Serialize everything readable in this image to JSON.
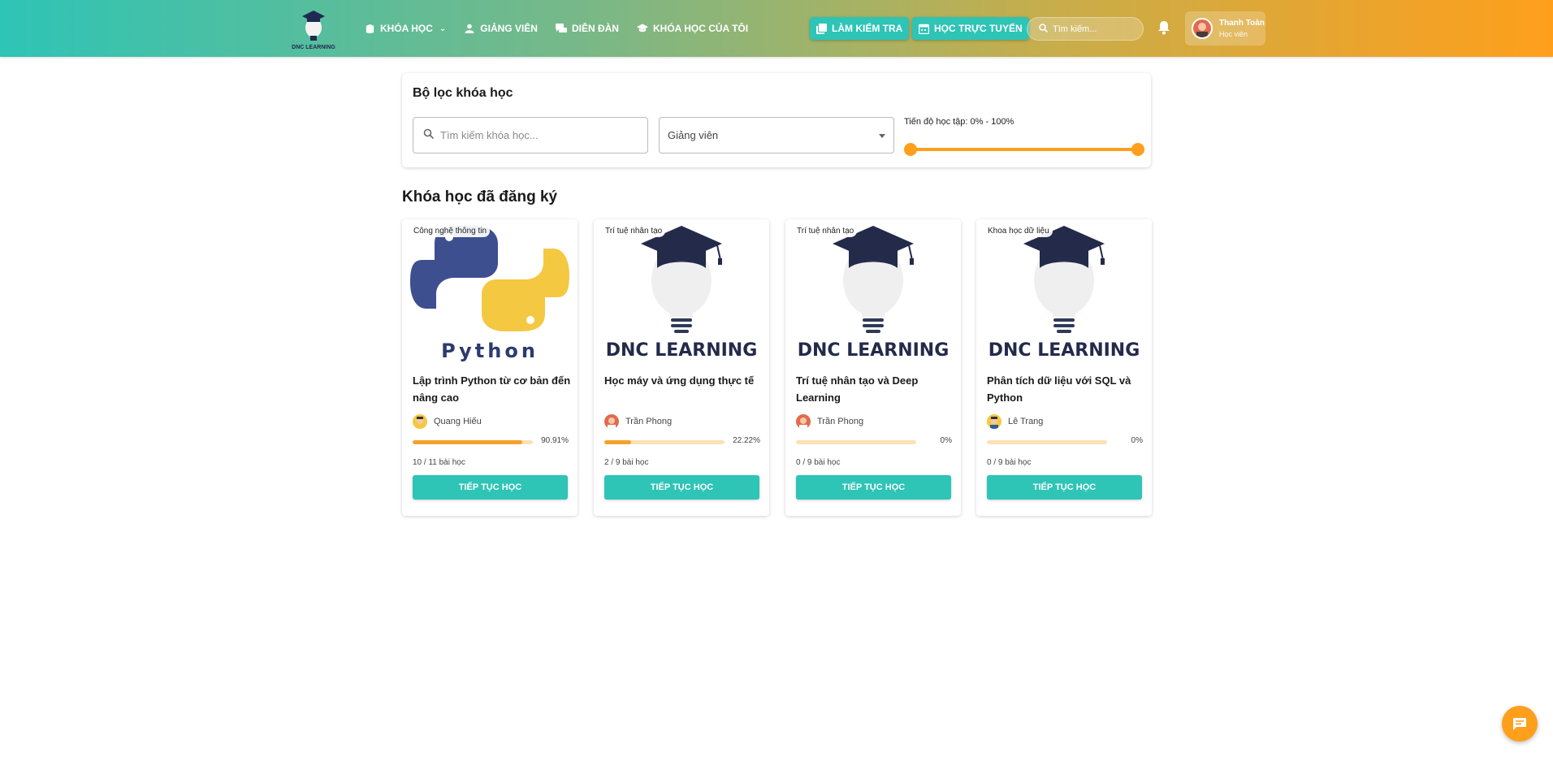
{
  "header": {
    "logo_text": "DNC LEARNING",
    "nav": [
      {
        "label": "KHÓA HỌC",
        "icon": "book-icon"
      },
      {
        "label": "GIẢNG VIÊN",
        "icon": "person-icon"
      },
      {
        "label": "DIỄN ĐÀN",
        "icon": "forum-icon"
      },
      {
        "label": "KHÓA HỌC CỦA TÔI",
        "icon": "school-icon"
      }
    ],
    "btn_test": "LÀM KIỂM TRA",
    "btn_online": "HỌC TRỰC TUYẾN",
    "search_placeholder": "Tìm kiếm...",
    "user": {
      "name": "Thanh Toàn",
      "role": "Học viên"
    }
  },
  "filter": {
    "title": "Bộ lọc khóa học",
    "search_placeholder": "Tìm kiếm khóa học...",
    "instructor_select": "Giảng viên",
    "progress_label": "Tiến độ học tập: 0% - 100%",
    "progress_range": [
      0,
      100
    ]
  },
  "section_title": "Khóa học đã đăng ký",
  "courses": [
    {
      "category": "Công nghệ thông tin",
      "image_text": "Python",
      "title": "Lập trình Python từ cơ bản đến nâng cao",
      "instructor": "Quang Hiếu",
      "progress": 90.91,
      "progress_label": "90.91%",
      "lessons": "10 / 11 bài học",
      "button": "TIẾP TỤC HỌC"
    },
    {
      "category": "Trí tuệ nhân tạo",
      "image_text": "DNC LEARNING",
      "title": "Học máy và ứng dụng thực tế",
      "instructor": "Trần Phong",
      "progress": 22.22,
      "progress_label": "22.22%",
      "lessons": "2 / 9 bài học",
      "button": "TIẾP TỤC HỌC"
    },
    {
      "category": "Trí tuệ nhân tạo",
      "image_text": "DNC LEARNING",
      "title": "Trí tuệ nhân tạo và Deep Learning",
      "instructor": "Trần Phong",
      "progress": 0,
      "progress_label": "0%",
      "lessons": "0 / 9 bài học",
      "button": "TIẾP TỤC HỌC"
    },
    {
      "category": "Khoa học dữ liệu",
      "image_text": "DNC LEARNING",
      "title": "Phân tích dữ liệu với SQL và Python",
      "instructor": "Lê Trang",
      "progress": 0,
      "progress_label": "0%",
      "lessons": "0 / 9 bài học",
      "button": "TIẾP TỤC HỌC"
    }
  ],
  "colors": {
    "teal": "#2ec4b6",
    "orange": "#ff9f1c",
    "navy": "#1f2a52"
  }
}
